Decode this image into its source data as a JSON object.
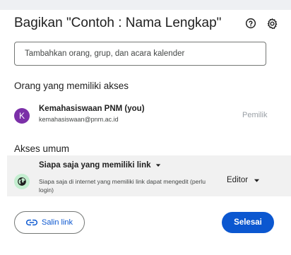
{
  "dialog": {
    "title": "Bagikan \"Contoh : Nama Lengkap\"",
    "help_icon": "help-circle-icon",
    "settings_icon": "gear-icon"
  },
  "add_people": {
    "placeholder": "Tambahkan orang, grup, dan acara kalender"
  },
  "people_section": {
    "title": "Orang yang memiliki akses",
    "people": [
      {
        "avatar_letter": "K",
        "avatar_color": "#7b2fa8",
        "name": "Kemahasiswaan PNM (you)",
        "email": "kemahasiswaan@pnm.ac.id",
        "role": "Pemilik"
      }
    ]
  },
  "general_access": {
    "title": "Akses umum",
    "option": "Siapa saja yang memiliki link",
    "description": "Siapa saja di internet yang memiliki link dapat mengedit (perlu login)",
    "role": "Editor",
    "icon_bg": "#c4eed0"
  },
  "footer": {
    "copy_link_label": "Salin link",
    "done_label": "Selesai"
  },
  "colors": {
    "primary": "#0b57d0",
    "row_highlight": "#f1f1f1"
  }
}
